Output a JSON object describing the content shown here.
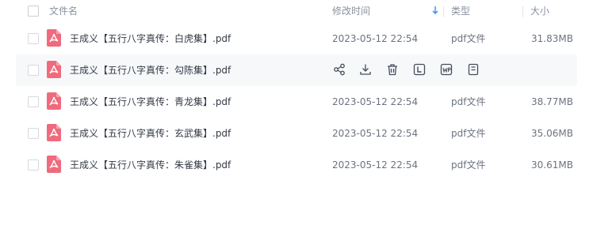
{
  "header": {
    "name": "文件名",
    "modified": "修改时间",
    "type": "类型",
    "size": "大小"
  },
  "rows": [
    {
      "name": "王成义【五行八字真传：白虎集】.pdf",
      "date": "2023-05-12 22:54",
      "type": "pdf文件",
      "size": "31.83MB"
    },
    {
      "name": "王成义【五行八字真传：勾陈集】.pdf"
    },
    {
      "name": "王成义【五行八字真传：青龙集】.pdf",
      "date": "2023-05-12 22:54",
      "type": "pdf文件",
      "size": "38.77MB"
    },
    {
      "name": "王成义【五行八字真传：玄武集】.pdf",
      "date": "2023-05-12 22:54",
      "type": "pdf文件",
      "size": "35.06MB"
    },
    {
      "name": "王成义【五行八字真传：朱雀集】.pdf",
      "date": "2023-05-12 22:54",
      "type": "pdf文件",
      "size": "30.61MB"
    }
  ],
  "hover_actions": [
    "share-icon",
    "download-icon",
    "delete-icon",
    "lock-icon",
    "video-icon",
    "document-icon"
  ],
  "colors": {
    "pdf_icon": "#f06a7d",
    "sort_arrow": "#2f8cf5",
    "hover_row": "#f7f8fa"
  }
}
